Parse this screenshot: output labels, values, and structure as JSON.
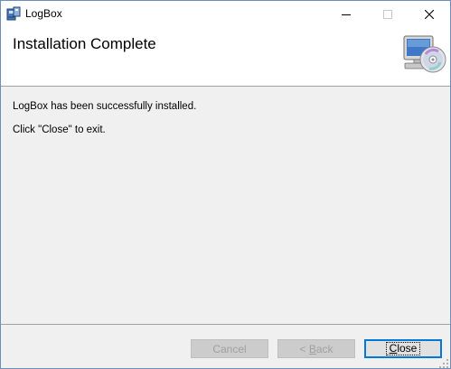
{
  "window": {
    "title": "LogBox",
    "icon": "installer-package-icon",
    "controls": [
      "minimize-icon",
      "maximize-icon",
      "close-icon"
    ]
  },
  "header": {
    "title": "Installation Complete",
    "icon": "computer-disc-icon"
  },
  "content": {
    "message": "LogBox has been successfully installed.",
    "instruction": "Click \"Close\" to exit."
  },
  "buttons": {
    "cancel": {
      "label": "Cancel",
      "enabled": false
    },
    "back": {
      "label_prefix": "< ",
      "label_accel": "B",
      "label_rest": "ack",
      "enabled": false
    },
    "close": {
      "label_accel": "C",
      "label_rest": "lose",
      "enabled": true,
      "default": true
    }
  },
  "colors": {
    "accent": "#0078d7",
    "dialog_background": "#f0f0f0",
    "header_background": "#ffffff"
  }
}
